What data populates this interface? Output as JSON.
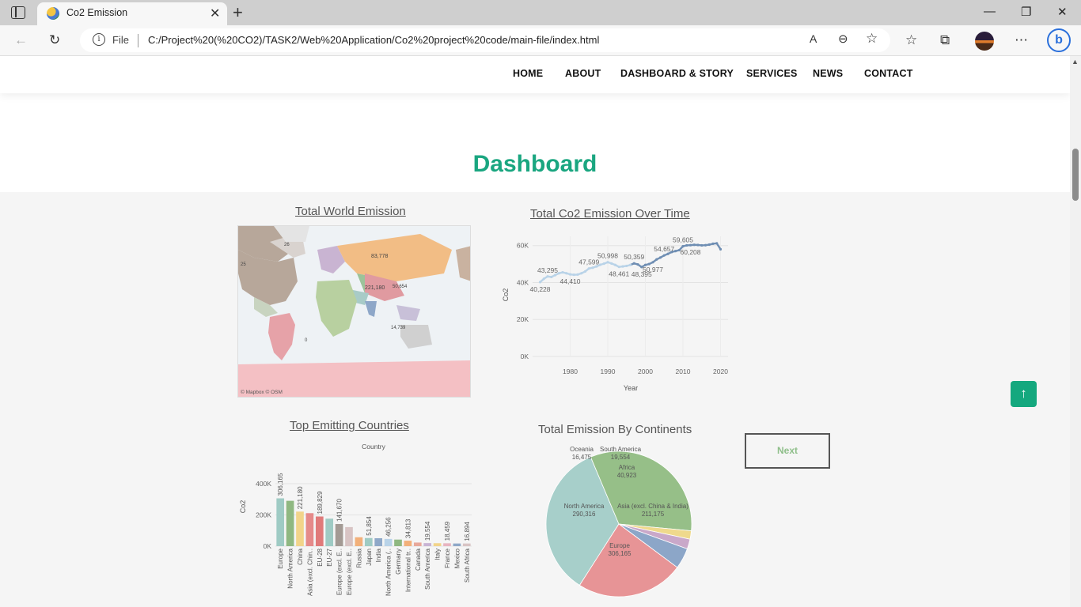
{
  "browser": {
    "tab_title": "Co2 Emission",
    "address_prefix": "File",
    "url": "C:/Project%20(%20CO2)/TASK2/Web%20Application/Co2%20project%20code/main-file/index.html"
  },
  "nav": {
    "items": [
      "HOME",
      "ABOUT",
      "DASHBOARD & STORY",
      "SERVICES",
      "NEWS",
      "CONTACT"
    ]
  },
  "page": {
    "title": "Dashboard",
    "next_label": "Next",
    "to_top_icon": "arrow-up-icon",
    "accent": "#1aa680"
  },
  "map": {
    "title": "Total World Emission",
    "attribution": "© Mapbox © OSM",
    "labels": [
      "83,778",
      "221,180",
      "50,654",
      "14,739",
      "25",
      "26",
      "0"
    ]
  },
  "chart_data": [
    {
      "type": "line",
      "title": "Total Co2 Emission Over Time",
      "xlabel": "Year",
      "ylabel": "Co2",
      "x": [
        1972,
        1973,
        1974,
        1975,
        1976,
        1977,
        1978,
        1979,
        1980,
        1981,
        1982,
        1983,
        1984,
        1985,
        1986,
        1987,
        1988,
        1989,
        1990,
        1991,
        1992,
        1993,
        1994,
        1995,
        1996,
        1997,
        1998,
        1999,
        2000,
        2001,
        2002,
        2003,
        2004,
        2005,
        2006,
        2007,
        2008,
        2009,
        2010,
        2011,
        2012,
        2013,
        2014,
        2015,
        2016,
        2017,
        2018,
        2019,
        2020
      ],
      "values": [
        40228,
        42000,
        43295,
        43000,
        44000,
        45000,
        45500,
        45000,
        44410,
        44200,
        44300,
        45000,
        46000,
        47599,
        48000,
        48700,
        49600,
        50200,
        50998,
        50300,
        49500,
        48461,
        48700,
        49000,
        49500,
        50359,
        49800,
        48395,
        49500,
        50000,
        50977,
        52500,
        53500,
        54657,
        55500,
        56500,
        57000,
        57500,
        59605,
        60100,
        60208,
        60400,
        60300,
        60100,
        60200,
        60500,
        61000,
        61200,
        58000
      ],
      "data_labels": [
        {
          "year": 1972,
          "value": "40,228"
        },
        {
          "year": 1974,
          "value": "43,295"
        },
        {
          "year": 1980,
          "value": "44,410"
        },
        {
          "year": 1985,
          "value": "47,599"
        },
        {
          "year": 1990,
          "value": "50,998"
        },
        {
          "year": 1993,
          "value": "48,461"
        },
        {
          "year": 1997,
          "value": "50,359"
        },
        {
          "year": 1999,
          "value": "48,395"
        },
        {
          "year": 2002,
          "value": "50,977"
        },
        {
          "year": 2005,
          "value": "54,657"
        },
        {
          "year": 2010,
          "value": "59,605"
        },
        {
          "year": 2012,
          "value": "60,208"
        }
      ],
      "y_ticks": [
        "0K",
        "20K",
        "40K",
        "60K"
      ],
      "x_ticks": [
        "1980",
        "1990",
        "2000",
        "2010",
        "2020"
      ],
      "ylim": [
        0,
        65000
      ],
      "xlim": [
        1970,
        2022
      ],
      "grid": true,
      "colors": [
        "#b9d3e8",
        "#6f8eb3"
      ]
    },
    {
      "type": "bar",
      "title": "Top Emitting Countries",
      "header": "Country",
      "ylabel": "Co2",
      "categories": [
        "Europe",
        "North America",
        "China",
        "Asia (excl. Chin..",
        "EU-28",
        "EU-27",
        "Europe (excl. E..",
        "Europe (excl. E..",
        "Russia",
        "Japan",
        "India",
        "North America (..",
        "Germany",
        "International tr..",
        "Canada",
        "South America",
        "Italy",
        "France",
        "Mexico",
        "South Africa"
      ],
      "values": [
        306165,
        290316,
        221180,
        211175,
        189829,
        176000,
        141670,
        122000,
        57000,
        51854,
        50654,
        46256,
        42000,
        34813,
        23000,
        19554,
        19000,
        18459,
        17000,
        16894
      ],
      "value_labels": [
        "306,165",
        "",
        "221,180",
        "",
        "189,829",
        "",
        "141,670",
        "",
        "",
        "51,854",
        "",
        "46,256",
        "",
        "34,813",
        "",
        "19,554",
        "",
        "18,459",
        "",
        "16,894"
      ],
      "y_ticks": [
        "0K",
        "200K",
        "400K"
      ],
      "ylim": [
        0,
        420000
      ],
      "colors": [
        "#9fcbc4",
        "#8fb881",
        "#f2d48a",
        "#e58a8a",
        "#e07a7a",
        "#9fcbc4",
        "#a39a94",
        "#d8c4c4",
        "#f2b07a",
        "#9fcbc4",
        "#8fa8c8",
        "#b9d3e8",
        "#8fb881",
        "#f2b07a",
        "#e8a89a",
        "#c8b4d4",
        "#f2d48a",
        "#e8b4c0",
        "#8fa8c8",
        "#d8c4c4"
      ]
    },
    {
      "type": "pie",
      "title": "Total Emission By Continents",
      "slices": [
        {
          "name": "Europe",
          "value": 306165,
          "label": "306,165",
          "color": "#a7cfca"
        },
        {
          "name": "North America",
          "value": 290316,
          "label": "290,316",
          "color": "#96bf88"
        },
        {
          "name": "Oceania",
          "value": 16475,
          "label": "16,475",
          "color": "#efd98c"
        },
        {
          "name": "South America",
          "value": 19554,
          "label": "19,554",
          "color": "#c9a8c9"
        },
        {
          "name": "Africa",
          "value": 40923,
          "label": "40,923",
          "color": "#8ca6c8"
        },
        {
          "name": "Asia (excl. China & India)",
          "value": 211175,
          "label": "211,175",
          "color": "#e79496"
        }
      ]
    }
  ]
}
